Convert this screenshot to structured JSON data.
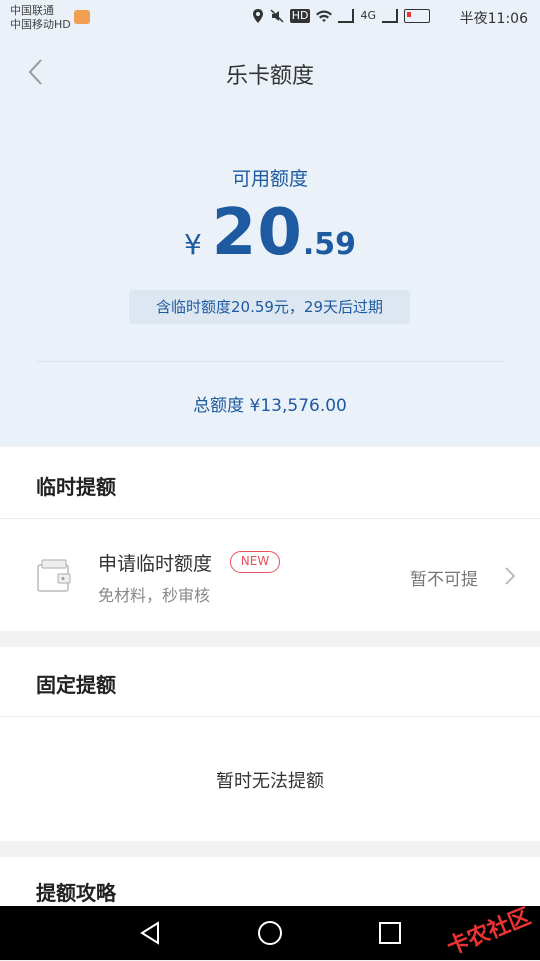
{
  "status_bar": {
    "carrier_1": "中国联通",
    "carrier_2": "中国移动HD",
    "network": "4G",
    "time": "半夜11:06"
  },
  "header": {
    "title": "乐卡额度",
    "available_label": "可用额度",
    "currency_symbol": "¥",
    "amount_integer": "20",
    "amount_decimal": ".59",
    "temp_note": "含临时额度20.59元，29天后过期",
    "total_label": "总额度 ¥13,576.00"
  },
  "temp_section": {
    "title": "临时提额",
    "apply_title": "申请临时额度",
    "badge": "NEW",
    "subtitle": "免材料，秒审核",
    "status": "暂不可提"
  },
  "fixed_section": {
    "title": "固定提额",
    "message": "暂时无法提额"
  },
  "strategy_section": {
    "title": "提额攻略"
  },
  "watermark": "卡农社区",
  "colors": {
    "accent_blue": "#1e5aa0",
    "header_bg": "#eaf1f8",
    "badge_red": "#e8505b"
  }
}
